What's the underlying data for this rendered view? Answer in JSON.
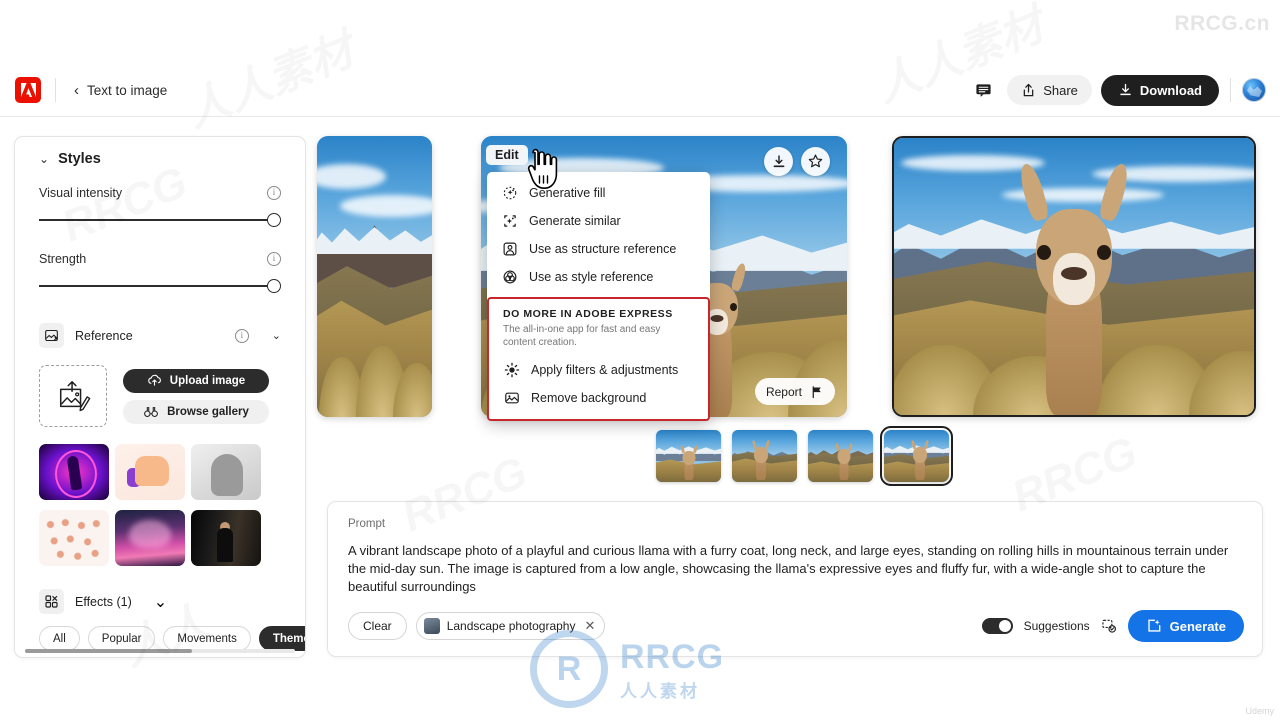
{
  "header": {
    "logo_alt": "adobe-logo",
    "back_label": "‹",
    "title": "Text to image",
    "share_label": "Share",
    "download_label": "Download"
  },
  "sidebar": {
    "section_title": "Styles",
    "controls": [
      {
        "label": "Visual intensity",
        "value": 100
      },
      {
        "label": "Strength",
        "value": 100
      }
    ],
    "reference": {
      "label": "Reference"
    },
    "upload": {
      "upload_label": "Upload image",
      "browse_label": "Browse gallery"
    },
    "style_presets": [
      {
        "name": "neon-dancer"
      },
      {
        "name": "3d-thumbs-up"
      },
      {
        "name": "marble-statue"
      },
      {
        "name": "pose-sheet"
      },
      {
        "name": "pink-clouds"
      },
      {
        "name": "cinematic-portrait"
      }
    ],
    "effects": {
      "label": "Effects (1)"
    },
    "effect_tabs": [
      {
        "label": "All",
        "active": false
      },
      {
        "label": "Popular",
        "active": false
      },
      {
        "label": "Movements",
        "active": false
      },
      {
        "label": "Themes",
        "active": true
      }
    ]
  },
  "context_menu": {
    "trigger_label": "Edit",
    "items": [
      {
        "label": "Generative fill",
        "icon": "generative-fill-icon"
      },
      {
        "label": "Generate similar",
        "icon": "generate-similar-icon"
      },
      {
        "label": "Use as structure reference",
        "icon": "structure-reference-icon"
      },
      {
        "label": "Use as style reference",
        "icon": "style-reference-icon"
      }
    ],
    "express": {
      "title": "DO MORE IN ADOBE EXPRESS",
      "subtitle": "The all-in-one app for fast and easy content creation.",
      "items": [
        {
          "label": "Apply filters & adjustments",
          "icon": "brightness-icon"
        },
        {
          "label": "Remove background",
          "icon": "remove-background-icon"
        }
      ],
      "highlight_color": "#c8262a"
    }
  },
  "results": {
    "report_label": "Report",
    "thumbnails": [
      {
        "name": "variation-1",
        "selected": false
      },
      {
        "name": "variation-2",
        "selected": false
      },
      {
        "name": "variation-3",
        "selected": false
      },
      {
        "name": "variation-4",
        "selected": true
      }
    ]
  },
  "prompt_panel": {
    "label": "Prompt",
    "text": "A vibrant landscape photo of a playful and curious llama with a furry coat, long neck, and large eyes, standing on rolling hills in mountainous terrain under the mid-day sun. The image is captured from a low angle, showcasing the llama's expressive eyes and fluffy fur, with a wide-angle shot to capture the beautiful surroundings",
    "clear_label": "Clear",
    "chip_label": "Landscape photography",
    "chip_remove": "✕",
    "suggestions_label": "Suggestions",
    "suggestions_on": true,
    "generate_label": "Generate",
    "accent_color": "#1473e6"
  },
  "watermarks": {
    "top_right": "RRCG.cn",
    "bottom_right": "Udemy",
    "center_main": "RRCG",
    "center_sub": "人人素材",
    "center_mark": "R"
  }
}
